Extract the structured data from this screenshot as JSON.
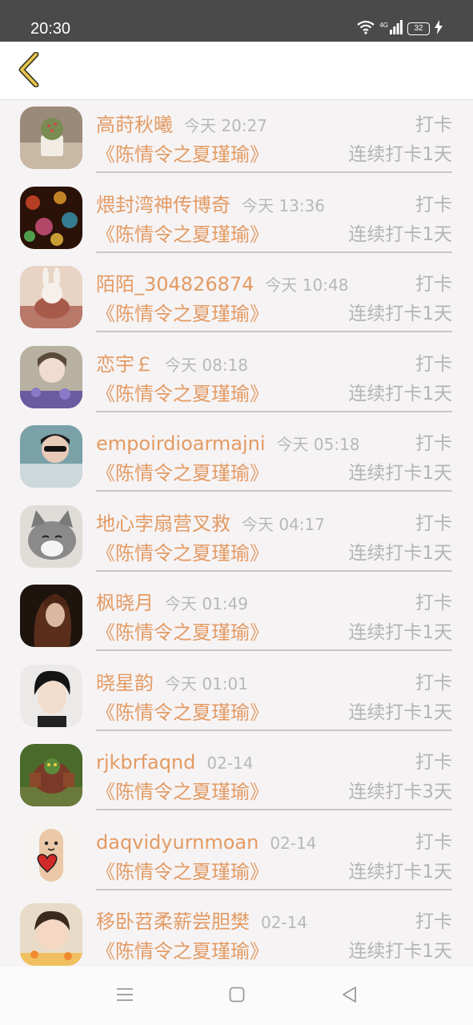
{
  "status_bar": {
    "time": "20:30",
    "battery": "32",
    "network": "4G"
  },
  "header": {
    "back_icon": "chevron-left-icon"
  },
  "feed": [
    {
      "name": "高莳秋曦",
      "time": "今天 20:27",
      "action": "打卡",
      "book": "《陈情令之夏瑾瑜》",
      "streak": "连续打卡1天",
      "avatar": "avatar-cactus"
    },
    {
      "name": "煨封湾神传博奇",
      "time": "今天 13:36",
      "action": "打卡",
      "book": "《陈情令之夏瑾瑜》",
      "streak": "连续打卡1天",
      "avatar": "avatar-bokeh"
    },
    {
      "name": "陌陌_304826874",
      "time": "今天 10:48",
      "action": "打卡",
      "book": "《陈情令之夏瑾瑜》",
      "streak": "连续打卡1天",
      "avatar": "avatar-bunny"
    },
    {
      "name": "恋宇￡",
      "time": "今天 08:18",
      "action": "打卡",
      "book": "《陈情令之夏瑾瑜》",
      "streak": "连续打卡1天",
      "avatar": "avatar-girl-flowers"
    },
    {
      "name": "empoirdioarmajni",
      "time": "今天 05:18",
      "action": "打卡",
      "book": "《陈情令之夏瑾瑜》",
      "streak": "连续打卡1天",
      "avatar": "avatar-sunglasses"
    },
    {
      "name": "地心孛扇营叉救",
      "time": "今天 04:17",
      "action": "打卡",
      "book": "《陈情令之夏瑾瑜》",
      "streak": "连续打卡1天",
      "avatar": "avatar-cat"
    },
    {
      "name": "枫晓月",
      "time": "今天 01:49",
      "action": "打卡",
      "book": "《陈情令之夏瑾瑜》",
      "streak": "连续打卡1天",
      "avatar": "avatar-dark-hair"
    },
    {
      "name": "晓星韵",
      "time": "今天 01:01",
      "action": "打卡",
      "book": "《陈情令之夏瑾瑜》",
      "streak": "连续打卡1天",
      "avatar": "avatar-short-hair"
    },
    {
      "name": "rjkbrfaqnd",
      "time": "02-14",
      "action": "打卡",
      "book": "《陈情令之夏瑾瑜》",
      "streak": "连续打卡3天",
      "avatar": "avatar-game-character"
    },
    {
      "name": "daqvidyurnmoan",
      "time": "02-14",
      "action": "打卡",
      "book": "《陈情令之夏瑾瑜》",
      "streak": "连续打卡1天",
      "avatar": "avatar-finger-heart"
    },
    {
      "name": "移卧苕柔薪尝胆樊",
      "time": "02-14",
      "action": "打卡",
      "book": "《陈情令之夏瑾瑜》",
      "streak": "连续打卡1天",
      "avatar": "avatar-child"
    }
  ],
  "nav": {
    "menu_icon": "menu-icon",
    "home_icon": "home-square-icon",
    "back_icon": "back-triangle-icon"
  },
  "colors": {
    "name": "#e39b63",
    "secondary": "#b4b4b4",
    "accent": "#e8c54a",
    "status_bar": "#4a4a4a"
  }
}
